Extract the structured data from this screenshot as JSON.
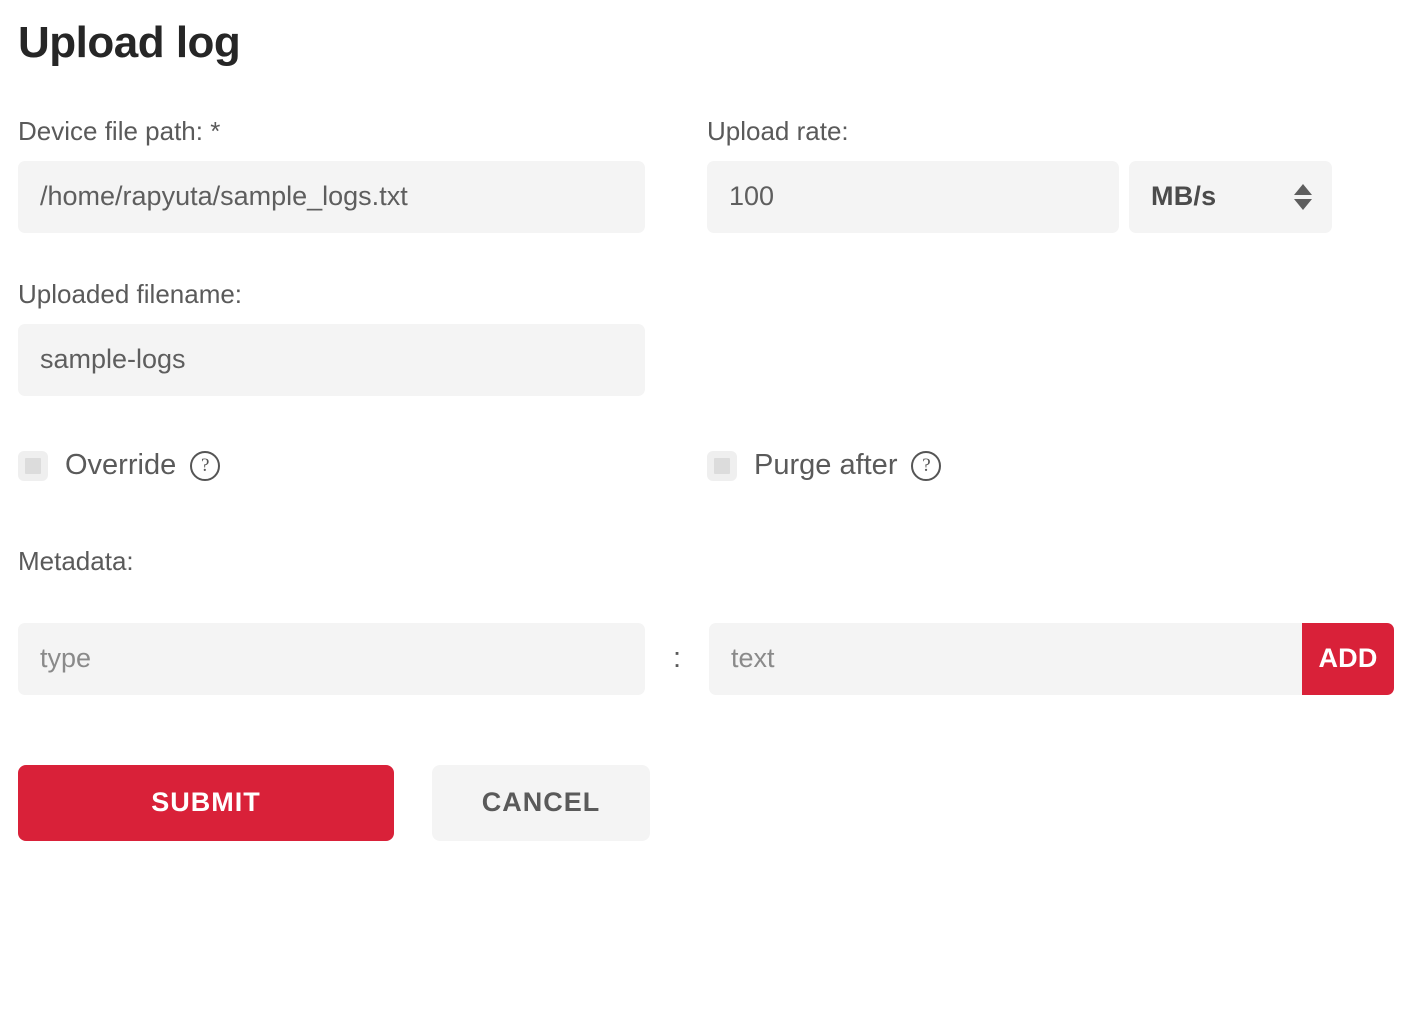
{
  "title": "Upload log",
  "fields": {
    "device_file_path": {
      "label": "Device file path: *",
      "value": "/home/rapyuta/sample_logs.txt",
      "placeholder": "/home/rapyuta/sample_logs.txt"
    },
    "upload_rate": {
      "label": "Upload rate:",
      "value": "100",
      "placeholder": "100",
      "unit": "MB/s",
      "unit_options": [
        "MB/s"
      ],
      "stepper_icon": "stepper-updown-icon"
    },
    "uploaded_filename": {
      "label": "Uploaded filename:",
      "value": "sample-logs",
      "placeholder": "sample-logs"
    }
  },
  "checkboxes": [
    {
      "label": "Override",
      "checked": false,
      "help_icon": "question-circle-icon",
      "help_glyph": "?"
    },
    {
      "label": "Purge after",
      "checked": false,
      "help_icon": "question-circle-icon",
      "help_glyph": "?"
    }
  ],
  "metadata": {
    "label": "Metadata:",
    "key_value": "",
    "key_placeholder": "type",
    "separator": ":",
    "value_value": "",
    "value_placeholder": "text",
    "add_label": "ADD"
  },
  "actions": {
    "submit_label": "SUBMIT",
    "cancel_label": "CANCEL"
  },
  "colors": {
    "accent_red": "#d92139",
    "input_background": "#f4f4f4",
    "label_text": "#5a5a5a",
    "title_text": "#262626",
    "page_background": "#ffffff"
  }
}
